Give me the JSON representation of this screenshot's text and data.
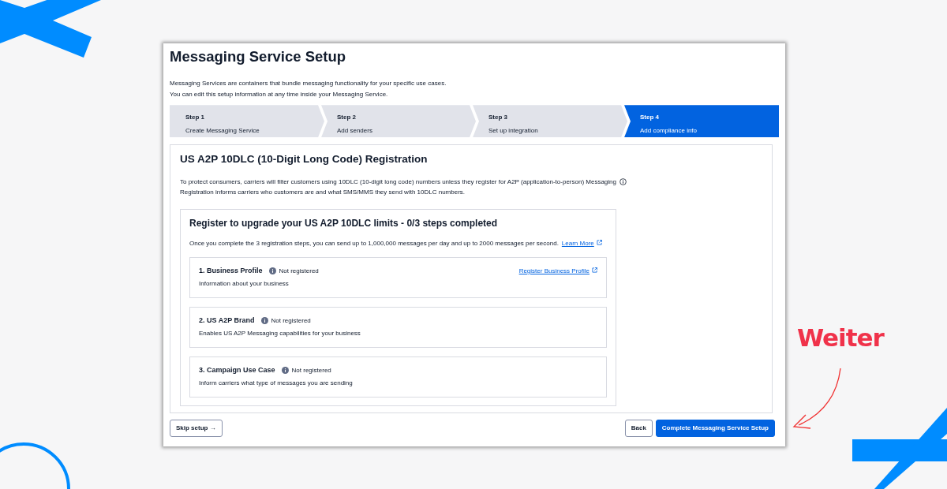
{
  "page": {
    "title": "Messaging Service Setup",
    "intro": [
      "Messaging Services are containers that bundle messaging functionality for your specific use cases.",
      "You can edit this setup information at any time inside your Messaging Service."
    ]
  },
  "steps": [
    {
      "label": "Step 1",
      "name": "Create Messaging Service",
      "selected": false
    },
    {
      "label": "Step 2",
      "name": "Add senders",
      "selected": false
    },
    {
      "label": "Step 3",
      "name": "Set up integration",
      "selected": false
    },
    {
      "label": "Step 4",
      "name": "Add compliance info",
      "selected": true
    }
  ],
  "section": {
    "title": "US A2P 10DLC (10-Digit Long Code) Registration",
    "description": [
      "To protect consumers, carriers will filter customers using 10DLC (10-digit long code) numbers unless they register for A2P (application-to-person) Messaging",
      "Registration informs carriers who customers are and what SMS/MMS they send with 10DLC numbers."
    ]
  },
  "registration": {
    "title": "Register to upgrade your US A2P 10DLC limits - 0/3 steps completed",
    "summary": "Once you complete the 3 registration steps, you can send up to 1,000,000 messages per day and up to 2000 messages per second.",
    "link": "Learn More"
  },
  "items": [
    {
      "title": "1. Business Profile",
      "status": "Not registered",
      "description": "Information about your business",
      "link": "Register Business Profile"
    },
    {
      "title": "2. US A2P Brand",
      "status": "Not registered",
      "description": "Enables US A2P Messaging capabilities for your business"
    },
    {
      "title": "3. Campaign Use Case",
      "status": "Not registered",
      "description": "Inform carriers what type of messages you are sending"
    }
  ],
  "footer": {
    "skip": "Skip setup",
    "skip_arrow": "→",
    "back": "Back",
    "complete": "Complete Messaging Service Setup"
  },
  "annotation": {
    "label": "Weiter"
  }
}
